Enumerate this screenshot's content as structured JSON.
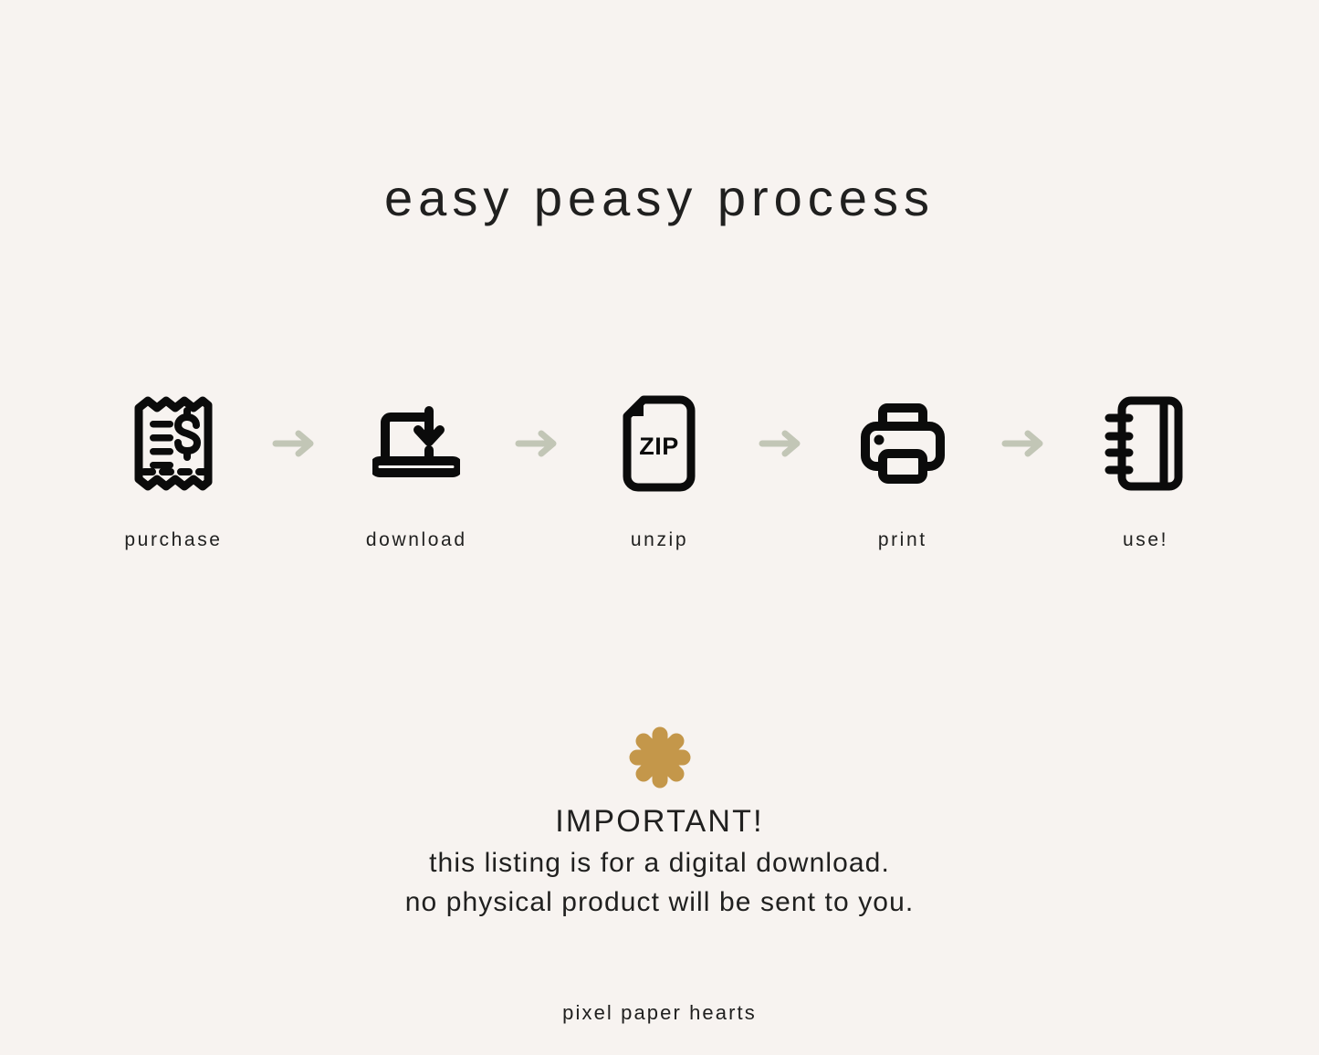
{
  "page": {
    "background_color": "#F7F3F0",
    "text_color": "#20201F",
    "accent_color": "#C4974A",
    "arrow_color": "#C2C6B6"
  },
  "title": "easy peasy process",
  "steps": [
    {
      "label": "purchase",
      "icon": "receipt-dollar-icon"
    },
    {
      "label": "download",
      "icon": "laptop-download-icon"
    },
    {
      "label": "unzip",
      "icon": "zip-file-icon",
      "file_type": "ZIP"
    },
    {
      "label": "print",
      "icon": "printer-icon"
    },
    {
      "label": "use!",
      "icon": "spiral-notebook-icon"
    }
  ],
  "arrows": {
    "icon": "arrow-right-icon",
    "count": 4,
    "color": "#C2C6B6"
  },
  "notice": {
    "starburst_icon": "asterisk-starburst-icon",
    "starburst_color": "#C4974A",
    "heading": "IMPORTANT!",
    "line1": "this listing is for a digital download.",
    "line2": "no physical product will be sent to you."
  },
  "footer": {
    "brand": "pixel paper hearts"
  }
}
